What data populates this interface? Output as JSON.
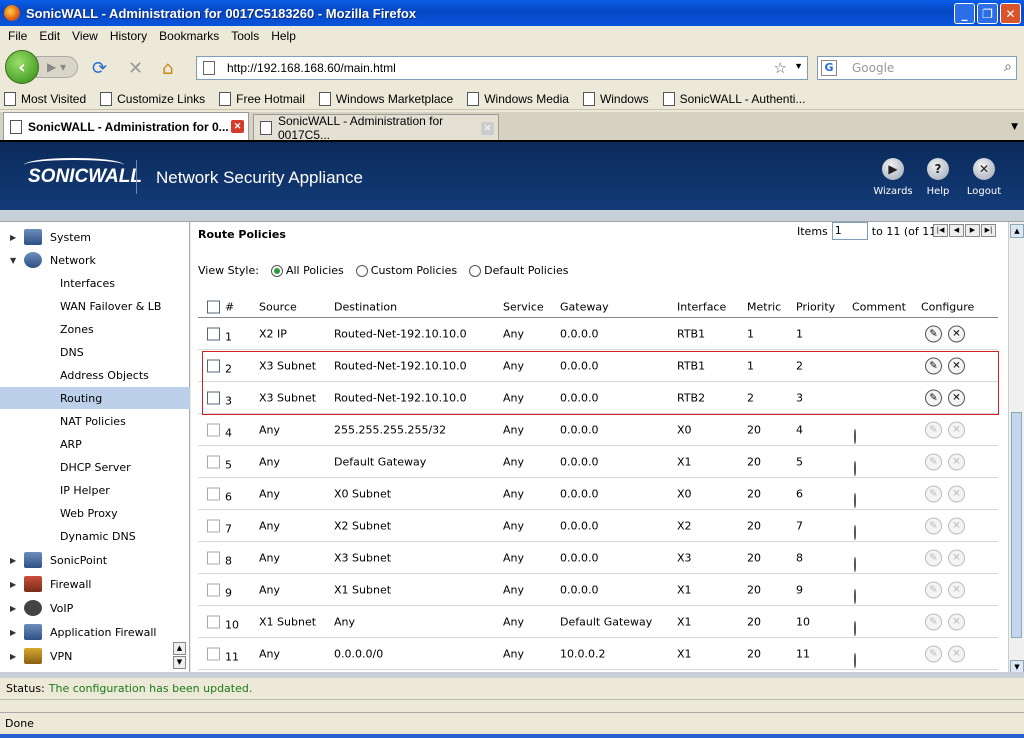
{
  "window": {
    "title": "SonicWALL - Administration for 0017C5183260 - Mozilla Firefox"
  },
  "menu": [
    "File",
    "Edit",
    "View",
    "History",
    "Bookmarks",
    "Tools",
    "Help"
  ],
  "address": {
    "url": "http://192.168.168.60/main.html",
    "search_placeholder": "Google"
  },
  "bookmarks": [
    "Most Visited",
    "Customize Links",
    "Free Hotmail",
    "Windows Marketplace",
    "Windows Media",
    "Windows",
    "SonicWALL - Authenti..."
  ],
  "tabs": [
    {
      "label": "SonicWALL - Administration for 0..."
    },
    {
      "label": "SonicWALL - Administration for 0017C5..."
    }
  ],
  "banner": {
    "logo": "SONICWALL",
    "app": "Network Security Appliance",
    "buttons": [
      {
        "label": "Wizards"
      },
      {
        "label": "Help"
      },
      {
        "label": "Logout"
      }
    ]
  },
  "sidebar": {
    "items": [
      {
        "label": "System",
        "level": 0
      },
      {
        "label": "Network",
        "level": 0
      },
      {
        "label": "Interfaces",
        "level": 1
      },
      {
        "label": "WAN Failover & LB",
        "level": 1
      },
      {
        "label": "Zones",
        "level": 1
      },
      {
        "label": "DNS",
        "level": 1
      },
      {
        "label": "Address Objects",
        "level": 1
      },
      {
        "label": "Routing",
        "level": 1,
        "selected": true
      },
      {
        "label": "NAT Policies",
        "level": 1
      },
      {
        "label": "ARP",
        "level": 1
      },
      {
        "label": "DHCP Server",
        "level": 1
      },
      {
        "label": "IP Helper",
        "level": 1
      },
      {
        "label": "Web Proxy",
        "level": 1
      },
      {
        "label": "Dynamic DNS",
        "level": 1
      },
      {
        "label": "SonicPoint",
        "level": 0
      },
      {
        "label": "Firewall",
        "level": 0
      },
      {
        "label": "VoIP",
        "level": 0
      },
      {
        "label": "Application Firewall",
        "level": 0
      },
      {
        "label": "VPN",
        "level": 0
      }
    ]
  },
  "route": {
    "title": "Route Policies",
    "items_label": "Items",
    "items_value": "1",
    "items_range": "to 11 (of 11)",
    "view_style_label": "View Style:",
    "view_options": [
      {
        "label": "All Policies",
        "selected": true
      },
      {
        "label": "Custom Policies",
        "selected": false
      },
      {
        "label": "Default Policies",
        "selected": false
      }
    ],
    "columns": [
      "#",
      "Source",
      "Destination",
      "Service",
      "Gateway",
      "Interface",
      "Metric",
      "Priority",
      "Comment",
      "Configure"
    ],
    "rows": [
      {
        "num": "1",
        "source": "X2 IP",
        "destination": "Routed-Net-192.10.10.0",
        "service": "Any",
        "gateway": "0.0.0.0",
        "interface": "RTB1",
        "metric": "1",
        "priority": "1",
        "comment": false,
        "custom": true
      },
      {
        "num": "2",
        "source": "X3 Subnet",
        "destination": "Routed-Net-192.10.10.0",
        "service": "Any",
        "gateway": "0.0.0.0",
        "interface": "RTB1",
        "metric": "1",
        "priority": "2",
        "comment": false,
        "custom": true
      },
      {
        "num": "3",
        "source": "X3 Subnet",
        "destination": "Routed-Net-192.10.10.0",
        "service": "Any",
        "gateway": "0.0.0.0",
        "interface": "RTB2",
        "metric": "2",
        "priority": "3",
        "comment": false,
        "custom": true
      },
      {
        "num": "4",
        "source": "Any",
        "destination": "255.255.255.255/32",
        "service": "Any",
        "gateway": "0.0.0.0",
        "interface": "X0",
        "metric": "20",
        "priority": "4",
        "comment": true,
        "custom": false
      },
      {
        "num": "5",
        "source": "Any",
        "destination": "Default Gateway",
        "service": "Any",
        "gateway": "0.0.0.0",
        "interface": "X1",
        "metric": "20",
        "priority": "5",
        "comment": true,
        "custom": false
      },
      {
        "num": "6",
        "source": "Any",
        "destination": "X0 Subnet",
        "service": "Any",
        "gateway": "0.0.0.0",
        "interface": "X0",
        "metric": "20",
        "priority": "6",
        "comment": true,
        "custom": false
      },
      {
        "num": "7",
        "source": "Any",
        "destination": "X2 Subnet",
        "service": "Any",
        "gateway": "0.0.0.0",
        "interface": "X2",
        "metric": "20",
        "priority": "7",
        "comment": true,
        "custom": false
      },
      {
        "num": "8",
        "source": "Any",
        "destination": "X3 Subnet",
        "service": "Any",
        "gateway": "0.0.0.0",
        "interface": "X3",
        "metric": "20",
        "priority": "8",
        "comment": true,
        "custom": false
      },
      {
        "num": "9",
        "source": "Any",
        "destination": "X1 Subnet",
        "service": "Any",
        "gateway": "0.0.0.0",
        "interface": "X1",
        "metric": "20",
        "priority": "9",
        "comment": true,
        "custom": false
      },
      {
        "num": "10",
        "source": "X1 Subnet",
        "destination": "Any",
        "service": "Any",
        "gateway": "Default Gateway",
        "interface": "X1",
        "metric": "20",
        "priority": "10",
        "comment": true,
        "custom": false
      },
      {
        "num": "11",
        "source": "Any",
        "destination": "0.0.0.0/0",
        "service": "Any",
        "gateway": "10.0.0.2",
        "interface": "X1",
        "metric": "20",
        "priority": "11",
        "comment": true,
        "custom": false
      }
    ]
  },
  "status": {
    "label": "Status:",
    "message": "The configuration has been updated."
  },
  "browser_status": "Done"
}
